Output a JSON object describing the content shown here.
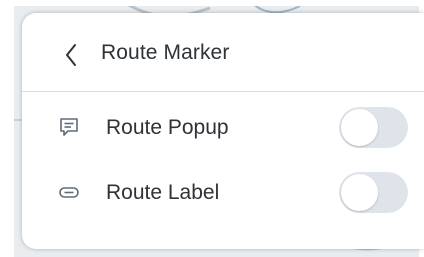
{
  "panel": {
    "title": "Route Marker",
    "back_icon": "chevron-left-icon"
  },
  "options": [
    {
      "label": "Route Popup",
      "icon": "popup-message-icon",
      "enabled": false
    },
    {
      "label": "Route Label",
      "icon": "label-tag-icon",
      "enabled": false
    }
  ],
  "colors": {
    "text": "#2e3338",
    "icon": "#5f6b77",
    "toggle_off": "#dfe4eb",
    "divider": "#d9dee2"
  }
}
